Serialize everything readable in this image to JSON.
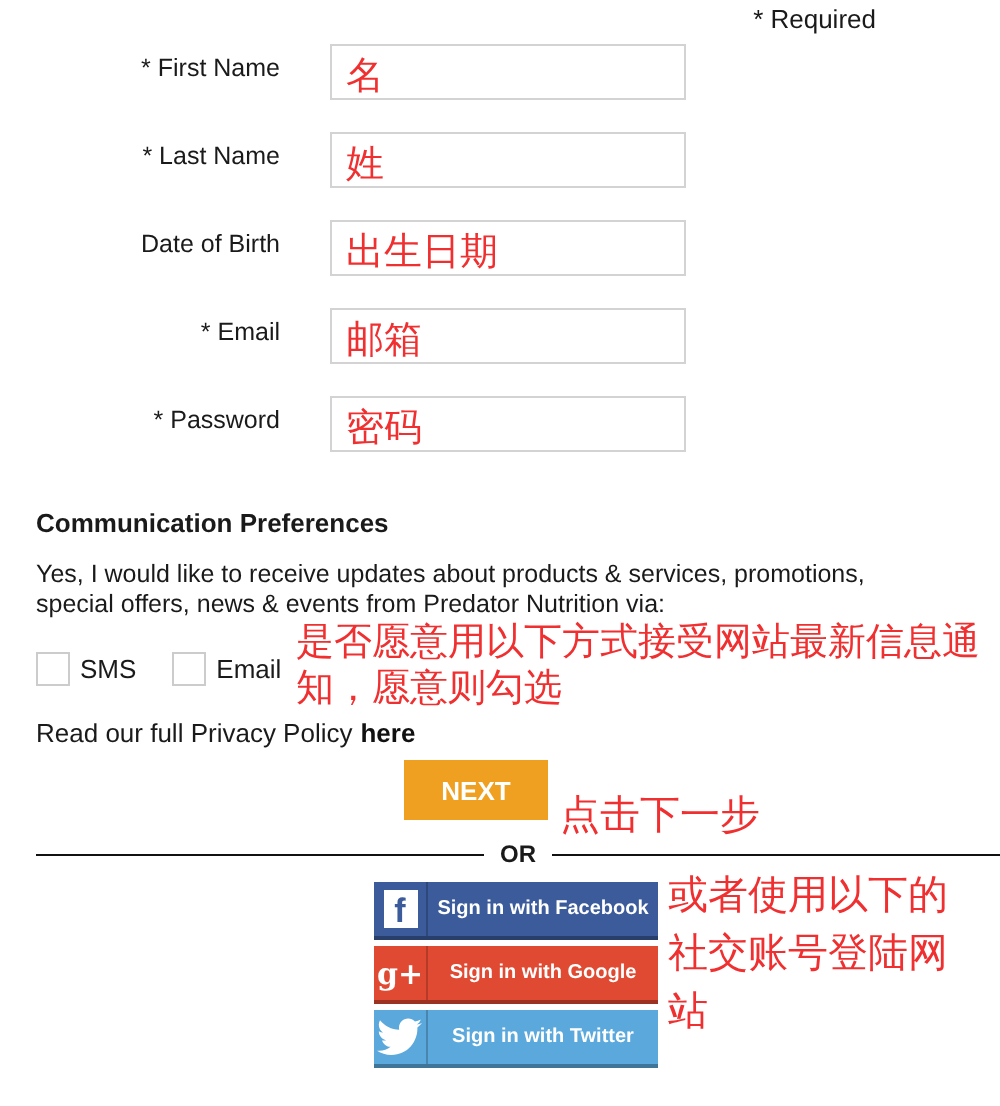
{
  "required_note": "* Required",
  "fields": [
    {
      "label": "* First Name",
      "annotation": "名"
    },
    {
      "label": "* Last Name",
      "annotation": "姓"
    },
    {
      "label": "Date of Birth",
      "annotation": "出生日期"
    },
    {
      "label": "* Email",
      "annotation": "邮箱"
    },
    {
      "label": "* Password",
      "annotation": "密码"
    }
  ],
  "preferences": {
    "heading": "Communication Preferences",
    "text": "Yes, I would like to receive updates about products & services, promotions, special offers, news & events from Predator Nutrition via:",
    "options": [
      {
        "label": "SMS",
        "checked": false
      },
      {
        "label": "Email",
        "checked": false
      }
    ],
    "annotation": "是否愿意用以下方式接受网站最新信息通知，愿意则勾选"
  },
  "privacy": {
    "text": "Read our full Privacy Policy",
    "link": "here"
  },
  "next_button": {
    "label": "NEXT",
    "annotation": "点击下一步"
  },
  "divider_label": "OR",
  "social_buttons": [
    {
      "kind": "facebook",
      "glyph": "f",
      "label": "Sign in with Facebook"
    },
    {
      "kind": "google",
      "glyph": "g+",
      "label": "Sign in with Google"
    },
    {
      "kind": "twitter",
      "label": "Sign in with Twitter"
    }
  ],
  "social_annotation": "或者使用以下的社交账号登陆网站"
}
